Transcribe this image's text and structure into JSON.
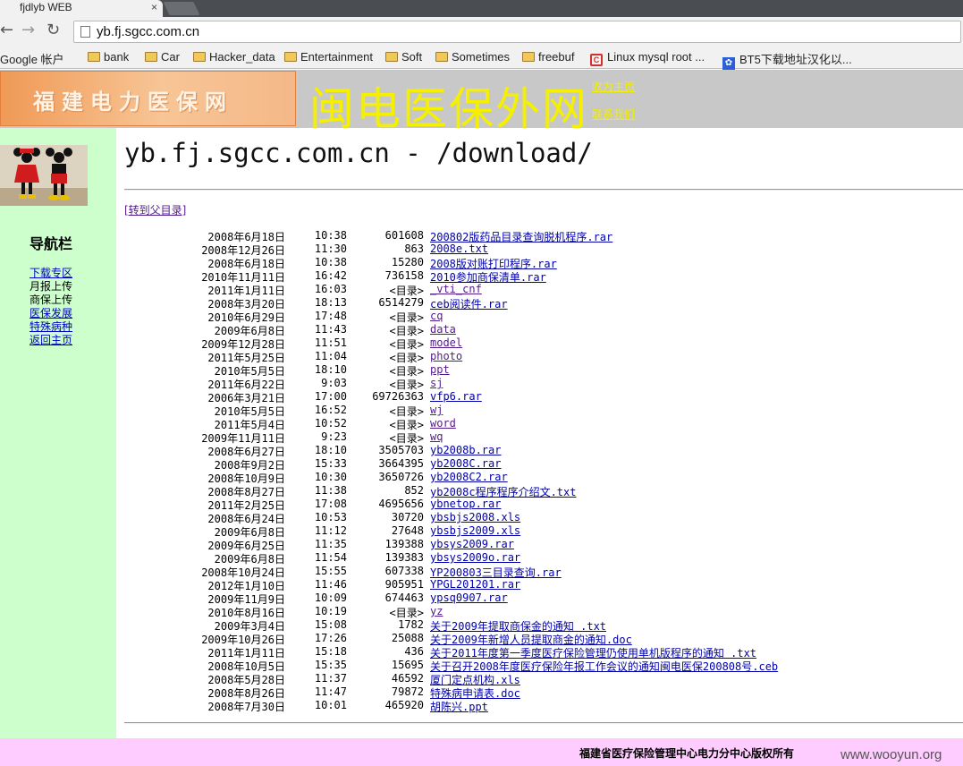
{
  "browser": {
    "tab_title": "fjdlyb WEB",
    "tab_close": "×",
    "back": "←",
    "forward": "→",
    "reload": "↻",
    "url": "yb.fj.sgcc.com.cn",
    "bookmarks": [
      {
        "label": "Google 帐户",
        "icon": "google-icon"
      },
      {
        "label": "bank",
        "icon": "folder-icon"
      },
      {
        "label": "Car",
        "icon": "folder-icon"
      },
      {
        "label": "Hacker_data",
        "icon": "folder-icon"
      },
      {
        "label": "Entertainment",
        "icon": "folder-icon"
      },
      {
        "label": "Soft",
        "icon": "folder-icon"
      },
      {
        "label": "Sometimes",
        "icon": "folder-icon"
      },
      {
        "label": "freebuf",
        "icon": "folder-icon"
      },
      {
        "label": "Linux mysql root ...",
        "icon": "site-icon"
      },
      {
        "label": "BT5下载地址汉化以...",
        "icon": "baidu-icon"
      }
    ]
  },
  "header": {
    "logo_text": "福建电力医保网",
    "title": "闽电医保外网",
    "link_home": "收为主页",
    "link_contact": "联系我们"
  },
  "sidebar": {
    "nav_title": "导航栏",
    "items": [
      {
        "label": "下载专区",
        "link": true
      },
      {
        "label": "月报上传",
        "link": false
      },
      {
        "label": "商保上传",
        "link": false
      },
      {
        "label": "医保发展",
        "link": true
      },
      {
        "label": "特殊病种",
        "link": true
      },
      {
        "label": "返回主页",
        "link": true
      }
    ]
  },
  "main": {
    "title": "yb.fj.sgcc.com.cn - /download/",
    "parent_link": "[转到父目录]",
    "files": [
      {
        "date": "2008年6月18日",
        "time": "10:38",
        "size": "601608",
        "name": "200802版药品目录查询脱机程序.rar"
      },
      {
        "date": "2008年12月26日",
        "time": "11:30",
        "size": "863",
        "name": "2008e.txt"
      },
      {
        "date": "2008年6月18日",
        "time": "10:38",
        "size": "15280",
        "name": "2008版对账打印程序.rar"
      },
      {
        "date": "2010年11月11日",
        "time": "16:42",
        "size": "736158",
        "name": "2010参加商保清单.rar"
      },
      {
        "date": "2011年1月11日",
        "time": "16:03",
        "size": "<目录>",
        "name": "_vti_cnf"
      },
      {
        "date": "2008年3月20日",
        "time": "18:13",
        "size": "6514279",
        "name": "ceb阅读件.rar"
      },
      {
        "date": "2010年6月29日",
        "time": "17:48",
        "size": "<目录>",
        "name": "cq"
      },
      {
        "date": "2009年6月8日",
        "time": "11:43",
        "size": "<目录>",
        "name": "data"
      },
      {
        "date": "2009年12月28日",
        "time": "11:51",
        "size": "<目录>",
        "name": "model"
      },
      {
        "date": "2011年5月25日",
        "time": "11:04",
        "size": "<目录>",
        "name": "photo"
      },
      {
        "date": "2010年5月5日",
        "time": "18:10",
        "size": "<目录>",
        "name": "ppt"
      },
      {
        "date": "2011年6月22日",
        "time": "9:03",
        "size": "<目录>",
        "name": "sj"
      },
      {
        "date": "2006年3月21日",
        "time": "17:00",
        "size": "69726363",
        "name": "vfp6.rar"
      },
      {
        "date": "2010年5月5日",
        "time": "16:52",
        "size": "<目录>",
        "name": "wj"
      },
      {
        "date": "2011年5月4日",
        "time": "10:52",
        "size": "<目录>",
        "name": "word"
      },
      {
        "date": "2009年11月11日",
        "time": "9:23",
        "size": "<目录>",
        "name": "wq"
      },
      {
        "date": "2008年6月27日",
        "time": "18:10",
        "size": "3505703",
        "name": "yb2008b.rar"
      },
      {
        "date": "2008年9月2日",
        "time": "15:33",
        "size": "3664395",
        "name": "yb2008C.rar"
      },
      {
        "date": "2008年10月9日",
        "time": "10:30",
        "size": "3650726",
        "name": "yb2008C2.rar"
      },
      {
        "date": "2008年8月27日",
        "time": "11:38",
        "size": "852",
        "name": "yb2008c程序程序介绍文.txt"
      },
      {
        "date": "2011年2月25日",
        "time": "17:08",
        "size": "4695656",
        "name": "ybnetop.rar"
      },
      {
        "date": "2008年6月24日",
        "time": "10:53",
        "size": "30720",
        "name": "ybsbjs2008.xls"
      },
      {
        "date": "2009年6月8日",
        "time": "11:12",
        "size": "27648",
        "name": "ybsbjs2009.xls"
      },
      {
        "date": "2009年6月25日",
        "time": "11:35",
        "size": "139388",
        "name": "ybsys2009.rar"
      },
      {
        "date": "2009年6月8日",
        "time": "11:54",
        "size": "139383",
        "name": "ybsys2009o.rar"
      },
      {
        "date": "2008年10月24日",
        "time": "15:55",
        "size": "607338",
        "name": "YP200803三目录查询.rar"
      },
      {
        "date": "2012年1月10日",
        "time": "11:46",
        "size": "905951",
        "name": "YPGL201201.rar"
      },
      {
        "date": "2009年11月9日",
        "time": "10:09",
        "size": "674463",
        "name": "ypsq0907.rar"
      },
      {
        "date": "2010年8月16日",
        "time": "10:19",
        "size": "<目录>",
        "name": "yz"
      },
      {
        "date": "2009年3月4日",
        "time": "15:08",
        "size": "1782",
        "name": "关于2009年提取商保金的通知 .txt"
      },
      {
        "date": "2009年10月26日",
        "time": "17:26",
        "size": "25088",
        "name": "关于2009年新增人员提取商金的通知.doc"
      },
      {
        "date": "2011年1月11日",
        "time": "15:18",
        "size": "436",
        "name": "关于2011年度第一季度医疗保险管理仍使用单机版程序的通知 .txt"
      },
      {
        "date": "2008年10月5日",
        "time": "15:35",
        "size": "15695",
        "name": "关于召开2008年度医疗保险年报工作会议的通知闽电医保200808号.ceb"
      },
      {
        "date": "2008年5月28日",
        "time": "11:37",
        "size": "46592",
        "name": "厦门定点机构.xls"
      },
      {
        "date": "2008年8月26日",
        "time": "11:47",
        "size": "79872",
        "name": "特殊病申请表.doc"
      },
      {
        "date": "2008年7月30日",
        "time": "10:01",
        "size": "465920",
        "name": "胡陈兴.ppt"
      }
    ]
  },
  "footer": {
    "copyright": "福建省医疗保险管理中心电力分中心版权所有",
    "watermark": "www.wooyun.org"
  }
}
